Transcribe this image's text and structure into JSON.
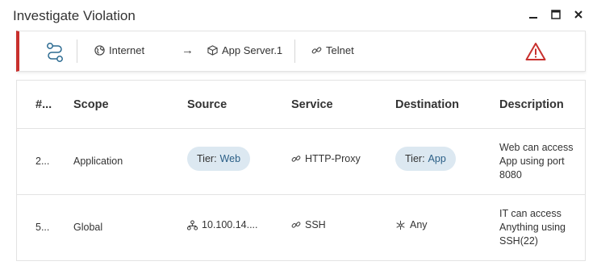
{
  "dialog": {
    "title": "Investigate Violation"
  },
  "window_controls": [
    "minimize",
    "maximize",
    "close"
  ],
  "path": {
    "source": "Internet",
    "destination": "App Server.1",
    "service": "Telnet",
    "alert_color": "#c8302d"
  },
  "table": {
    "headers": {
      "index": "#...",
      "scope": "Scope",
      "source": "Source",
      "service": "Service",
      "destination": "Destination",
      "description": "Description"
    },
    "rows": [
      {
        "index": "2...",
        "scope": "Application",
        "source_key": "Tier:",
        "source_val": "Web",
        "service": "HTTP-Proxy",
        "dest_key": "Tier:",
        "dest_val": "App",
        "desc1": "Web can access",
        "desc2": "App using port",
        "desc3": "8080"
      },
      {
        "index": "5...",
        "scope": "Global",
        "source": "10.100.14....",
        "service": "SSH",
        "destination": "Any",
        "desc1": "IT can access",
        "desc2": "Anything using",
        "desc3": "SSH(22)"
      }
    ]
  }
}
